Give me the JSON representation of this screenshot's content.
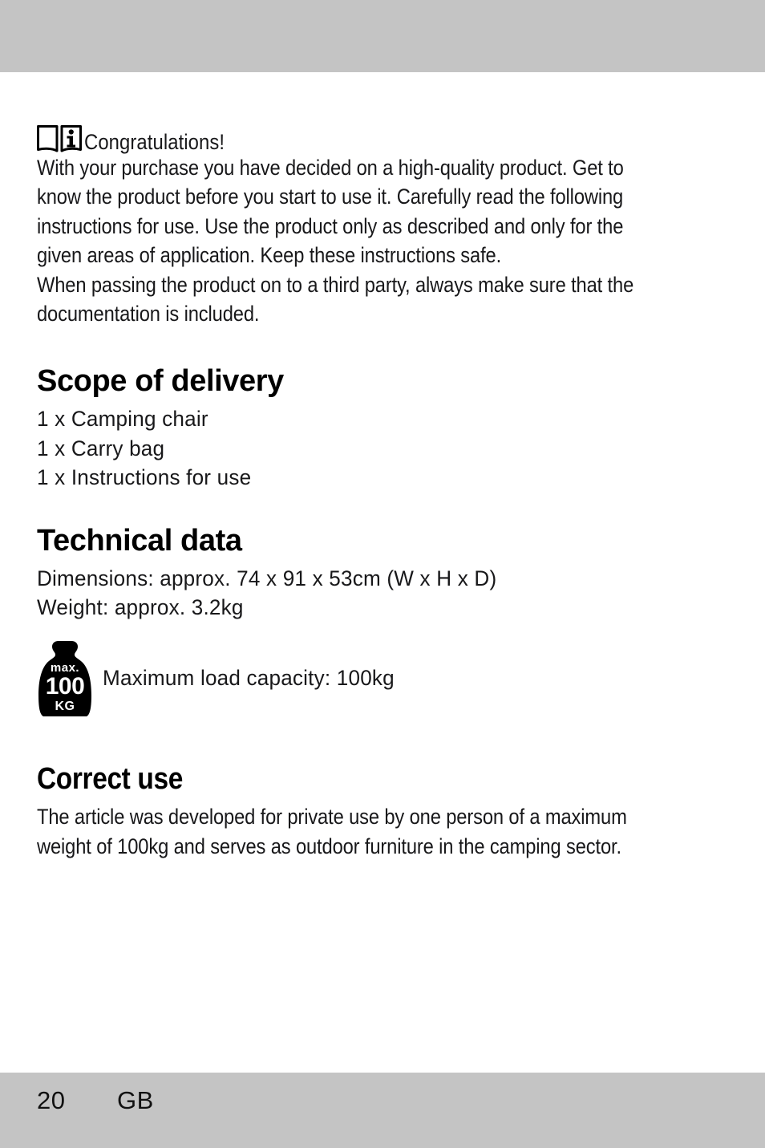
{
  "page": {
    "background_color": "#ffffff",
    "band_color": "#c4c4c4",
    "text_color": "#18181a"
  },
  "intro": {
    "icon_name": "read-instructions-booklet-icon",
    "congratulations": "Congratulations!",
    "lines": [
      "With your purchase you have decided on a high-quality product. Get to",
      "know the product before you start to use it. Carefully read the following",
      "instructions for use. Use the product only as described and only for the",
      "given areas of application. Keep these instructions safe.",
      "When passing the product on to a third party, always make sure that the",
      "documentation is included."
    ]
  },
  "scope_of_delivery": {
    "heading": "Scope of delivery",
    "items": [
      "1 x Camping chair",
      "1 x Carry bag",
      "1 x Instructions for use"
    ]
  },
  "technical_data": {
    "heading": "Technical data",
    "lines": [
      "Dimensions: approx. 74 x 91 x 53cm (W x H x D)",
      "Weight: approx. 3.2kg"
    ],
    "max_load": {
      "icon_name": "max-load-weight-icon",
      "icon_max_label": "max.",
      "icon_value": "100",
      "icon_unit": "KG",
      "text": "Maximum load capacity: 100kg"
    }
  },
  "correct_use": {
    "heading": "Correct use",
    "lines": [
      "The article was developed for private use by one person of a maximum",
      "weight of 100kg and serves as outdoor furniture in the camping sector."
    ]
  },
  "footer": {
    "page_number": "20",
    "language_code": "GB"
  }
}
